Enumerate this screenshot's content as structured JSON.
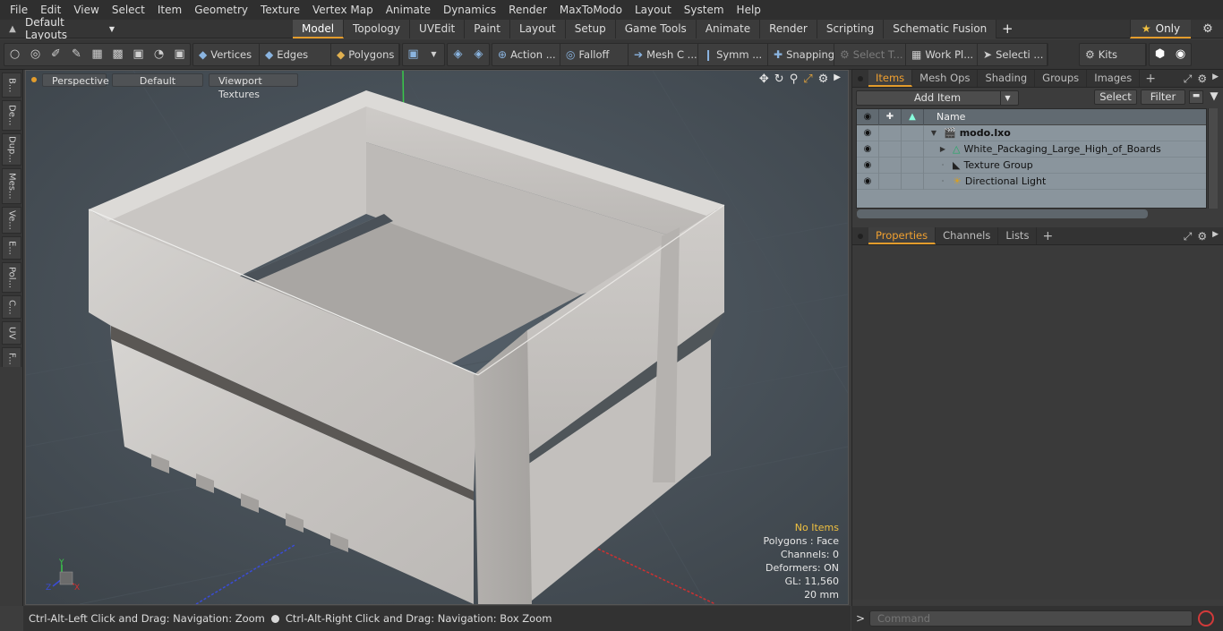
{
  "menu": [
    "File",
    "Edit",
    "View",
    "Select",
    "Item",
    "Geometry",
    "Texture",
    "Vertex Map",
    "Animate",
    "Dynamics",
    "Render",
    "MaxToModo",
    "Layout",
    "System",
    "Help"
  ],
  "layout": {
    "preset": "Default Layouts",
    "tabs": [
      "Model",
      "Topology",
      "UVEdit",
      "Paint",
      "Layout",
      "Setup",
      "Game Tools",
      "Animate",
      "Render",
      "Scripting",
      "Schematic Fusion"
    ],
    "active_tab": "Model",
    "only_label": "Only"
  },
  "toolbar": {
    "vertices": "Vertices",
    "edges": "Edges",
    "polygons": "Polygons",
    "action": "Action ...",
    "falloff": "Falloff",
    "mesh": "Mesh C ...",
    "symm": "Symm ...",
    "snapping": "Snapping",
    "select_t": "Select T...",
    "work_pl": "Work Pl...",
    "selecti": "Selecti ...",
    "kits": "Kits"
  },
  "left_tabs": [
    "B...",
    "De...",
    "Dup...",
    "Mes...",
    "Ve...",
    "E...",
    "Pol...",
    "C...",
    "UV",
    "F..."
  ],
  "viewport": {
    "view": "Perspective",
    "shading": "Default",
    "textures": "Viewport Textures",
    "info": {
      "selection": "No Items",
      "polygons": "Polygons : Face",
      "channels": "Channels: 0",
      "deformers": "Deformers: ON",
      "gl": "GL: 11,560",
      "scale": "20 mm"
    },
    "axis": {
      "x": "X",
      "y": "Y",
      "z": "Z"
    }
  },
  "status": {
    "left": "Ctrl-Alt-Left Click and Drag: Navigation: Zoom",
    "right": "Ctrl-Alt-Right Click and Drag: Navigation: Box Zoom"
  },
  "items_panel": {
    "tabs": [
      "Items",
      "Mesh Ops",
      "Shading",
      "Groups",
      "Images"
    ],
    "active_tab": "Items",
    "add_item": "Add Item",
    "select": "Select",
    "filter": "Filter",
    "column_name": "Name",
    "items": [
      {
        "label": "modo.lxo",
        "bold": true
      },
      {
        "label": "White_Packaging_Large_High_of_Boards",
        "bold": false
      },
      {
        "label": "Texture Group",
        "bold": false
      },
      {
        "label": "Directional Light",
        "bold": false
      }
    ]
  },
  "props_panel": {
    "tabs": [
      "Properties",
      "Channels",
      "Lists"
    ],
    "active_tab": "Properties"
  },
  "command": {
    "prompt": ">",
    "placeholder": "Command"
  },
  "colors": {
    "accent": "#e39c2c",
    "viewport_bg": "#4a5158",
    "list_bg": "#8a959d",
    "stop": "#d23a3a"
  }
}
